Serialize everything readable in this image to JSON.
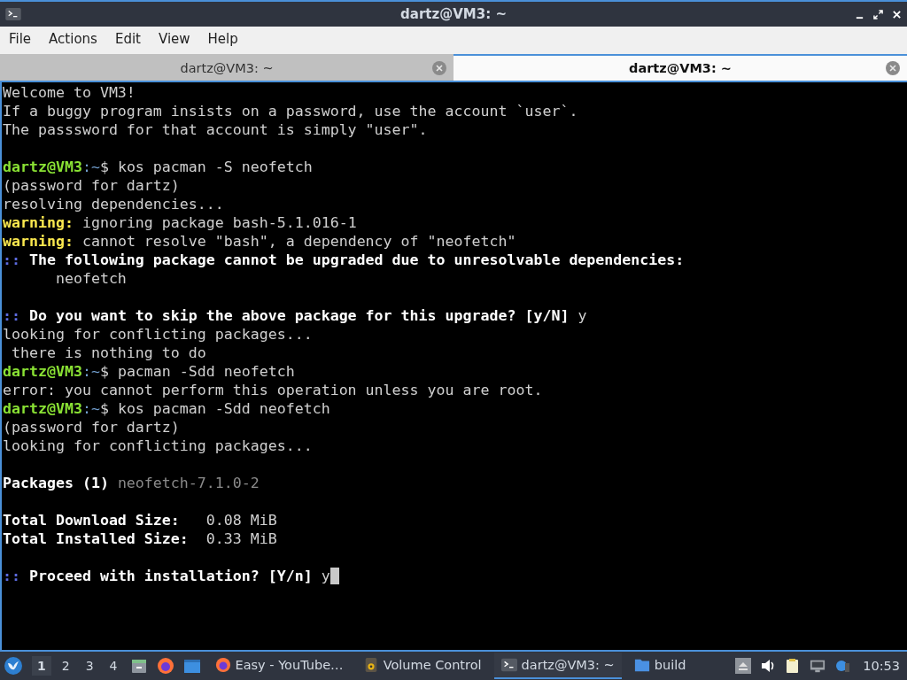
{
  "window": {
    "title": "dartz@VM3: ~"
  },
  "menu": [
    "File",
    "Actions",
    "Edit",
    "View",
    "Help"
  ],
  "tabs": [
    {
      "label": "dartz@VM3: ~",
      "selected": false
    },
    {
      "label": "dartz@VM3: ~",
      "selected": true
    }
  ],
  "terminal": {
    "lines": [
      {
        "segments": [
          {
            "kind": "text",
            "text": "Welcome to VM3!"
          }
        ]
      },
      {
        "segments": [
          {
            "kind": "text",
            "text": "If a buggy program insists on a password, use the account `user`."
          }
        ]
      },
      {
        "segments": [
          {
            "kind": "text",
            "text": "The passsword for that account is simply \"user\"."
          }
        ]
      },
      {
        "space_before": true,
        "segments": [
          {
            "kind": "user",
            "text": "dartz@VM3"
          },
          {
            "kind": "path",
            "text": ":~"
          },
          {
            "kind": "text",
            "text": "$ kos pacman -S neofetch"
          }
        ]
      },
      {
        "segments": [
          {
            "kind": "text",
            "text": "(password for dartz)"
          }
        ]
      },
      {
        "segments": [
          {
            "kind": "text",
            "text": "resolving dependencies..."
          }
        ]
      },
      {
        "segments": [
          {
            "kind": "warning",
            "text": "warning:"
          },
          {
            "kind": "text",
            "text": " ignoring package bash-5.1.016-1"
          }
        ]
      },
      {
        "segments": [
          {
            "kind": "warning",
            "text": "warning:"
          },
          {
            "kind": "text",
            "text": " cannot resolve \"bash\", a dependency of \"neofetch\""
          }
        ]
      },
      {
        "segments": [
          {
            "kind": "marker",
            "text": "::"
          },
          {
            "kind": "bold",
            "text": " The following package cannot be upgraded due to unresolvable dependencies:"
          }
        ]
      },
      {
        "segments": [
          {
            "kind": "text",
            "text": "      neofetch"
          }
        ]
      },
      {
        "space_before": true,
        "segments": [
          {
            "kind": "marker",
            "text": "::"
          },
          {
            "kind": "bold",
            "text": " Do you want to skip the above package for this upgrade? [y/N]"
          },
          {
            "kind": "text",
            "text": " y"
          }
        ]
      },
      {
        "segments": [
          {
            "kind": "text",
            "text": "looking for conflicting packages..."
          }
        ]
      },
      {
        "segments": [
          {
            "kind": "text",
            "text": " there is nothing to do"
          }
        ]
      },
      {
        "segments": [
          {
            "kind": "user",
            "text": "dartz@VM3"
          },
          {
            "kind": "path",
            "text": ":~"
          },
          {
            "kind": "text",
            "text": "$ pacman -Sdd neofetch"
          }
        ]
      },
      {
        "segments": [
          {
            "kind": "text",
            "text": "error: you cannot perform this operation unless you are root."
          }
        ]
      },
      {
        "segments": [
          {
            "kind": "user",
            "text": "dartz@VM3"
          },
          {
            "kind": "path",
            "text": ":~"
          },
          {
            "kind": "text",
            "text": "$ kos pacman -Sdd neofetch"
          }
        ]
      },
      {
        "segments": [
          {
            "kind": "text",
            "text": "(password for dartz)"
          }
        ]
      },
      {
        "segments": [
          {
            "kind": "text",
            "text": "looking for conflicting packages..."
          }
        ]
      },
      {
        "space_before": true,
        "segments": [
          {
            "kind": "bold",
            "text": "Packages (1)"
          },
          {
            "kind": "dim",
            "text": " neofetch-7.1.0-2"
          }
        ]
      },
      {
        "space_before": true,
        "segments": [
          {
            "kind": "bold",
            "text": "Total Download Size:"
          },
          {
            "kind": "text",
            "text": "   0.08 MiB"
          }
        ]
      },
      {
        "segments": [
          {
            "kind": "bold",
            "text": "Total Installed Size:"
          },
          {
            "kind": "text",
            "text": "  0.33 MiB"
          }
        ]
      },
      {
        "space_before": true,
        "segments": [
          {
            "kind": "marker",
            "text": "::"
          },
          {
            "kind": "bold",
            "text": " Proceed with installation? [Y/n]"
          },
          {
            "kind": "text",
            "text": " y"
          }
        ],
        "cursor": true
      }
    ]
  },
  "taskbar": {
    "workspaces": [
      {
        "label": "1",
        "selected": true
      },
      {
        "label": "2",
        "selected": false
      },
      {
        "label": "3",
        "selected": false
      },
      {
        "label": "4",
        "selected": false
      }
    ],
    "tasks": [
      {
        "kind": "firefox",
        "label": "Easy - YouTube…",
        "selected": false
      },
      {
        "kind": "speaker",
        "label": "Volume Control",
        "selected": false
      },
      {
        "kind": "terminal",
        "label": "dartz@VM3: ~",
        "selected": true
      },
      {
        "kind": "folder",
        "label": "build",
        "selected": false
      }
    ],
    "clock": "10:53"
  }
}
